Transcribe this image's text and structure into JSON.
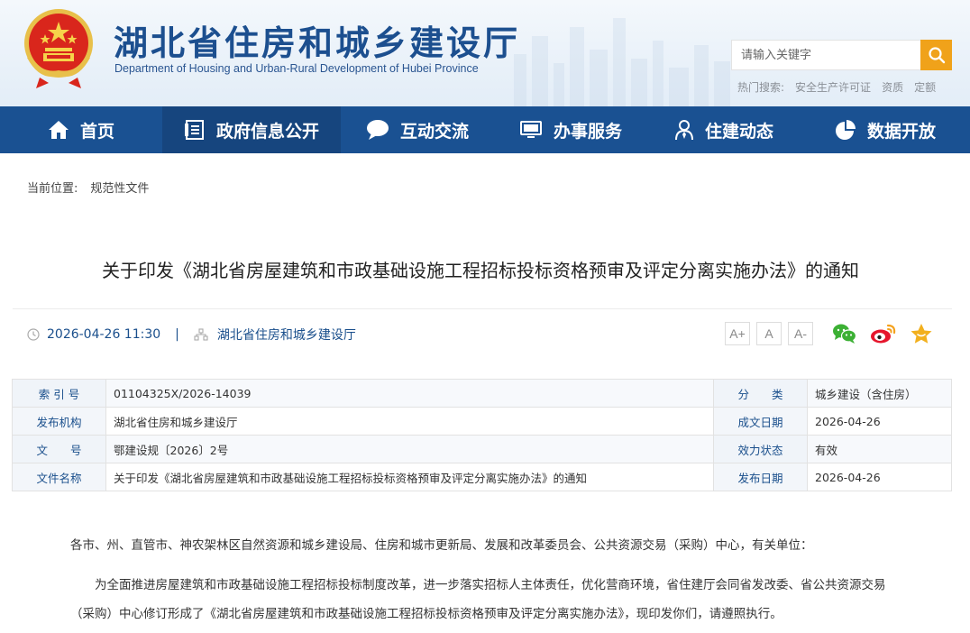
{
  "header": {
    "title": "湖北省住房和城乡建设厅",
    "subtitle": "Department of Housing and Urban-Rural Development of Hubei Province",
    "search_placeholder": "请输入关键字",
    "hot_label": "热门搜索:",
    "hot_keywords": [
      "安全生产许可证",
      "资质",
      "定额"
    ]
  },
  "nav": {
    "items": [
      {
        "label": "首页",
        "icon": "home-icon"
      },
      {
        "label": "政府信息公开",
        "icon": "document-list-icon"
      },
      {
        "label": "互动交流",
        "icon": "chat-bubble-icon"
      },
      {
        "label": "办事服务",
        "icon": "monitor-icon"
      },
      {
        "label": "住建动态",
        "icon": "person-icon"
      },
      {
        "label": "数据开放",
        "icon": "pie-chart-icon"
      }
    ],
    "active_index": 1
  },
  "breadcrumb": {
    "label": "当前位置:",
    "current": "规范性文件"
  },
  "article": {
    "title": "关于印发《湖北省房屋建筑和市政基础设施工程招标投标资格预审及评定分离实施办法》的通知",
    "datetime": "2026-04-26 11:30",
    "separator": "|",
    "source": "湖北省住房和城乡建设厅",
    "font_buttons": [
      "A+",
      "A",
      "A-"
    ]
  },
  "info": {
    "rows": [
      {
        "k1": "索 引 号",
        "v1": "01104325X/2026-14039",
        "k2": "分　　类",
        "v2": "城乡建设（含住房）"
      },
      {
        "k1": "发布机构",
        "v1": "湖北省住房和城乡建设厅",
        "k2": "成文日期",
        "v2": "2026-04-26"
      },
      {
        "k1": "文　　号",
        "v1": "鄂建设规〔2026〕2号",
        "k2": "效力状态",
        "v2": "有效"
      },
      {
        "k1": "文件名称",
        "v1": "关于印发《湖北省房屋建筑和市政基础设施工程招标投标资格预审及评定分离实施办法》的通知",
        "k2": "发布日期",
        "v2": "2026-04-26"
      }
    ]
  },
  "body": {
    "salutation": "各市、州、直管市、神农架林区自然资源和城乡建设局、住房和城市更新局、发展和改革委员会、公共资源交易（采购）中心，有关单位：",
    "paragraph1": "为全面推进房屋建筑和市政基础设施工程招标投标制度改革，进一步落实招标人主体责任，优化营商环境，省住建厅会同省发改委、省公共资源交易（采购）中心修订形成了《湖北省房屋建筑和市政基础设施工程招标投标资格预审及评定分离实施办法》，现印发你们，请遵照执行。"
  },
  "colors": {
    "nav_bg": "#1a5192",
    "nav_active": "#16457e",
    "title_blue": "#1c4f8f",
    "search_btn": "#f0a21a"
  }
}
